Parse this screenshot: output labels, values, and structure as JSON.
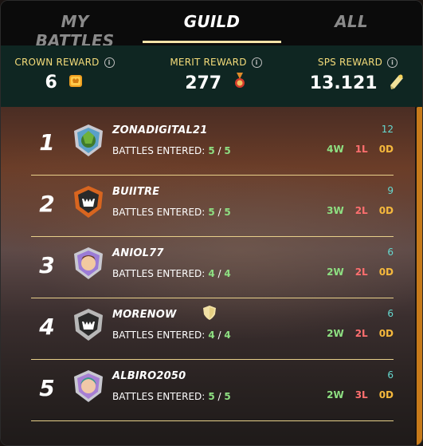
{
  "tabs": [
    {
      "label": "MY BATTLES",
      "active": false
    },
    {
      "label": "GUILD",
      "active": true
    },
    {
      "label": "ALL",
      "active": false
    }
  ],
  "rewards": {
    "crown": {
      "label": "CROWN REWARD",
      "value": "6",
      "icon": "crown-reward-icon"
    },
    "merit": {
      "label": "MERIT REWARD",
      "value": "277",
      "icon": "merit-medal-icon"
    },
    "sps": {
      "label": "SPS REWARD",
      "value": "13.121",
      "icon": "sps-scroll-icon"
    }
  },
  "battles_label": "BATTLES ENTERED:",
  "players": [
    {
      "rank": "1",
      "name": "ZONADIGITAL21",
      "entered": "5",
      "of": "5",
      "total": "12",
      "w": "4W",
      "l": "1L",
      "d": "0D",
      "avatar_color": "#5aa0c8"
    },
    {
      "rank": "2",
      "name": "BUIITRE",
      "entered": "5",
      "of": "5",
      "total": "9",
      "w": "3W",
      "l": "2L",
      "d": "0D",
      "avatar_color": "#d8651f"
    },
    {
      "rank": "3",
      "name": "ANIOL77",
      "entered": "4",
      "of": "4",
      "total": "6",
      "w": "2W",
      "l": "2L",
      "d": "0D",
      "avatar_color": "#9b7bd6"
    },
    {
      "rank": "4",
      "name": "MORENOW",
      "entered": "4",
      "of": "4",
      "total": "6",
      "w": "2W",
      "l": "2L",
      "d": "0D",
      "avatar_color": "#b8b8b8"
    },
    {
      "rank": "5",
      "name": "ALBIRO2050",
      "entered": "5",
      "of": "5",
      "total": "6",
      "w": "2W",
      "l": "3L",
      "d": "0D",
      "avatar_color": "#a77fd4"
    }
  ],
  "colors": {
    "accent": "#f5e3a8",
    "win": "#8ee082",
    "loss": "#ff6f6f",
    "draw": "#f5b83c",
    "total": "#66d9d0"
  }
}
